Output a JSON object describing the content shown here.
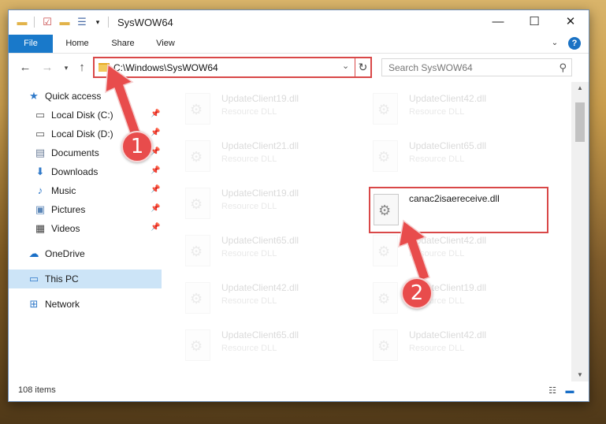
{
  "window": {
    "title": "SysWOW64",
    "controls": {
      "minimize": "—",
      "maximize": "☐",
      "close": "✕"
    }
  },
  "ribbon": {
    "tabs": [
      "File",
      "Home",
      "Share",
      "View"
    ],
    "help": "?"
  },
  "navigation": {
    "back": "←",
    "forward": "→",
    "recent": "▾",
    "up": "↑",
    "address_path": "C:\\Windows\\SysWOW64",
    "search_placeholder": "Search SysWOW64"
  },
  "sidebar": {
    "items": [
      {
        "label": "Quick access",
        "icon": "star-icon",
        "pinned": false
      },
      {
        "label": "Local Disk (C:)",
        "icon": "drive-icon",
        "pinned": true
      },
      {
        "label": "Local Disk (D:)",
        "icon": "drive-icon",
        "pinned": true
      },
      {
        "label": "Documents",
        "icon": "documents-icon",
        "pinned": true
      },
      {
        "label": "Downloads",
        "icon": "download-icon",
        "pinned": true
      },
      {
        "label": "Music",
        "icon": "music-icon",
        "pinned": true
      },
      {
        "label": "Pictures",
        "icon": "pictures-icon",
        "pinned": true
      },
      {
        "label": "Videos",
        "icon": "videos-icon",
        "pinned": true
      },
      {
        "label": "OneDrive",
        "icon": "cloud-icon",
        "pinned": false
      },
      {
        "label": "This PC",
        "icon": "computer-icon",
        "pinned": false,
        "selected": true
      },
      {
        "label": "Network",
        "icon": "network-icon",
        "pinned": false
      }
    ]
  },
  "files": [
    {
      "name": "UpdateClient19.dll",
      "type": "Resource DLL",
      "faded": true
    },
    {
      "name": "UpdateClient42.dll",
      "type": "Resource DLL",
      "faded": true
    },
    {
      "name": "UpdateClient21.dll",
      "type": "Resource DLL",
      "faded": true
    },
    {
      "name": "UpdateClient65.dll",
      "type": "Resource DLL",
      "faded": true
    },
    {
      "name": "UpdateClient19.dll",
      "type": "Resource DLL",
      "faded": true
    },
    {
      "name": "canac2isaereceive.dll",
      "type": "",
      "faded": false,
      "highlighted": true
    },
    {
      "name": "UpdateClient65.dll",
      "type": "Resource DLL",
      "faded": true
    },
    {
      "name": "UpdateClient42.dll",
      "type": "Resource DLL",
      "faded": true
    },
    {
      "name": "UpdateClient42.dll",
      "type": "Resource DLL",
      "faded": true
    },
    {
      "name": "UpdateClient19.dll",
      "type": "Resource DLL",
      "faded": true
    },
    {
      "name": "UpdateClient65.dll",
      "type": "Resource DLL",
      "faded": true
    },
    {
      "name": "UpdateClient42.dll",
      "type": "Resource DLL",
      "faded": true
    }
  ],
  "status": {
    "item_count": "108 items"
  },
  "annotations": {
    "step1": "1",
    "step2": "2"
  },
  "colors": {
    "accent": "#1979ca",
    "annotation_red": "#e84c4c",
    "highlight_border": "#d94848",
    "selection": "#cce4f7"
  }
}
